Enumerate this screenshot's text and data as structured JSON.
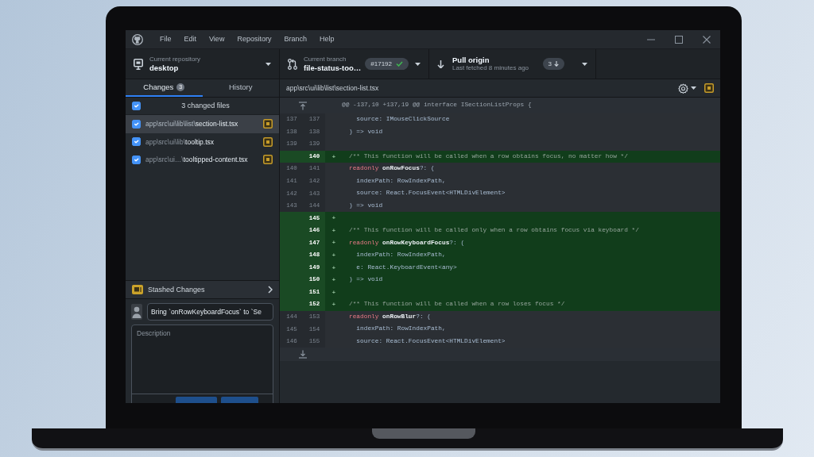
{
  "window": {
    "menu": [
      "File",
      "Edit",
      "View",
      "Repository",
      "Branch",
      "Help"
    ]
  },
  "toolbar": {
    "repository": {
      "label": "Current repository",
      "value": "desktop"
    },
    "branch": {
      "label": "Current branch",
      "value": "file-status-too…",
      "pull_request": "#17192",
      "checks_passed": true
    },
    "pull": {
      "label": "Pull origin",
      "subtitle": "Last fetched 8 minutes ago",
      "behind": "3"
    }
  },
  "sidebar": {
    "tabs": [
      {
        "label": "Changes",
        "count": "3",
        "selected": true
      },
      {
        "label": "History",
        "selected": false
      }
    ],
    "changes_header": {
      "label": "3 changed files",
      "checked": true
    },
    "files": [
      {
        "dir": "app\\src\\ui\\lib\\list\\",
        "name": "section-list.tsx",
        "checked": true,
        "selected": true
      },
      {
        "dir": "app\\src\\ui\\lib\\",
        "name": "tooltip.tsx",
        "checked": true,
        "selected": false
      },
      {
        "dir": "app\\src\\ui…\\",
        "name": "tooltipped-content.tsx",
        "checked": true,
        "selected": false
      }
    ],
    "stash": {
      "label": "Stashed Changes"
    },
    "commit": {
      "summary": "Bring `onRowKeyboardFocus` to `Se",
      "description_placeholder": "Description"
    }
  },
  "diff": {
    "path": "app\\src\\ui\\lib\\list\\section-list.tsx",
    "lines": [
      {
        "kind": "hunk",
        "text": "@@ -137,10 +137,19 @@ interface ISectionListProps {"
      },
      {
        "kind": "context",
        "old": "137",
        "new": "137",
        "selected": false,
        "tokens": [
          {
            "kind": "plain",
            "text": "  source: IMouseClickSource"
          }
        ]
      },
      {
        "kind": "context",
        "old": "138",
        "new": "138",
        "selected": false,
        "tokens": [
          {
            "kind": "plain",
            "text": ") => void"
          }
        ]
      },
      {
        "kind": "context",
        "old": "139",
        "new": "139",
        "selected": false
      },
      {
        "kind": "added",
        "new": "140",
        "marker": "+",
        "selected": true,
        "tokens": [
          {
            "kind": "comment",
            "text": "/** This function will be called when a row obtains focus, no matter how */"
          }
        ]
      },
      {
        "kind": "context",
        "old": "140",
        "new": "141",
        "selected": false,
        "tokens": [
          {
            "kind": "keyword",
            "text": "readonly"
          },
          {
            "kind": "name",
            "text": " onRowFocus"
          },
          {
            "kind": "plain",
            "text": "?: ("
          }
        ]
      },
      {
        "kind": "context",
        "old": "141",
        "new": "142",
        "selected": false,
        "tokens": [
          {
            "kind": "plain",
            "text": "  indexPath: RowIndexPath,"
          }
        ]
      },
      {
        "kind": "context",
        "old": "142",
        "new": "143",
        "selected": false,
        "tokens": [
          {
            "kind": "plain",
            "text": "  source: React.FocusEvent<HTMLDivElement>"
          }
        ]
      },
      {
        "kind": "context",
        "old": "143",
        "new": "144",
        "selected": false,
        "tokens": [
          {
            "kind": "plain",
            "text": ") => void"
          }
        ]
      },
      {
        "kind": "added",
        "new": "145",
        "marker": "+",
        "selected": true
      },
      {
        "kind": "added",
        "new": "146",
        "marker": "+",
        "selected": true,
        "tokens": [
          {
            "kind": "comment",
            "text": "/** This function will be called only when a row obtains focus via keyboard */"
          }
        ]
      },
      {
        "kind": "added",
        "new": "147",
        "marker": "+",
        "selected": true,
        "tokens": [
          {
            "kind": "keyword",
            "text": "readonly"
          },
          {
            "kind": "name",
            "text": " onRowKeyboardFocus"
          },
          {
            "kind": "plain",
            "text": "?: ("
          }
        ]
      },
      {
        "kind": "added",
        "new": "148",
        "marker": "+",
        "selected": true,
        "tokens": [
          {
            "kind": "plain",
            "text": "  indexPath: RowIndexPath,"
          }
        ]
      },
      {
        "kind": "added",
        "new": "149",
        "marker": "+",
        "selected": true,
        "tokens": [
          {
            "kind": "plain",
            "text": "  e: React.KeyboardEvent<any>"
          }
        ]
      },
      {
        "kind": "added",
        "new": "150",
        "marker": "+",
        "selected": true,
        "tokens": [
          {
            "kind": "plain",
            "text": ") => void"
          }
        ]
      },
      {
        "kind": "added",
        "new": "151",
        "marker": "+",
        "selected": true
      },
      {
        "kind": "added",
        "new": "152",
        "marker": "+",
        "selected": true,
        "tokens": [
          {
            "kind": "comment",
            "text": "/** This function will be called when a row loses focus */"
          }
        ]
      },
      {
        "kind": "context",
        "old": "144",
        "new": "153",
        "selected": false,
        "tokens": [
          {
            "kind": "keyword",
            "text": "readonly"
          },
          {
            "kind": "name",
            "text": " onRowBlur"
          },
          {
            "kind": "plain",
            "text": "?: ("
          }
        ]
      },
      {
        "kind": "context",
        "old": "145",
        "new": "154",
        "selected": false,
        "tokens": [
          {
            "kind": "plain",
            "text": "  indexPath: RowIndexPath,"
          }
        ]
      },
      {
        "kind": "context",
        "old": "146",
        "new": "155",
        "selected": false,
        "tokens": [
          {
            "kind": "plain",
            "text": "  source: React.FocusEvent<HTMLDivElement>"
          }
        ]
      }
    ]
  }
}
